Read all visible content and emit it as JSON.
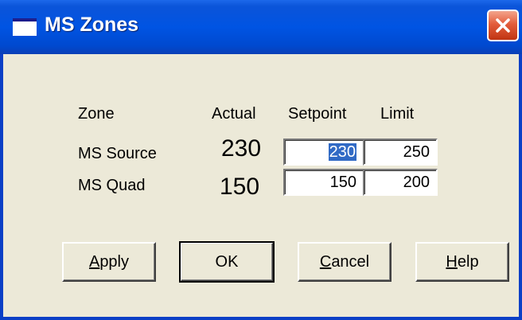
{
  "window": {
    "title": "MS Zones",
    "close_label": "close"
  },
  "table": {
    "headers": {
      "zone": "Zone",
      "actual": "Actual",
      "setpoint": "Setpoint",
      "limit": "Limit"
    },
    "rows": [
      {
        "zone": "MS Source",
        "actual": "230",
        "setpoint": "230",
        "limit": "250"
      },
      {
        "zone": "MS Quad",
        "actual": "150",
        "setpoint": "150",
        "limit": "200"
      }
    ]
  },
  "buttons": {
    "apply": {
      "mnemonic": "A",
      "rest": "pply"
    },
    "ok": "OK",
    "cancel": {
      "mnemonic": "C",
      "rest": "ancel"
    },
    "help": {
      "mnemonic": "H",
      "rest": "elp"
    }
  },
  "colors": {
    "titlebar": "#0054e3",
    "face": "#ece9d8",
    "selection": "#316ac5",
    "close": "#e35d3c"
  },
  "icons": {
    "window": "window-icon",
    "close": "close-icon"
  }
}
